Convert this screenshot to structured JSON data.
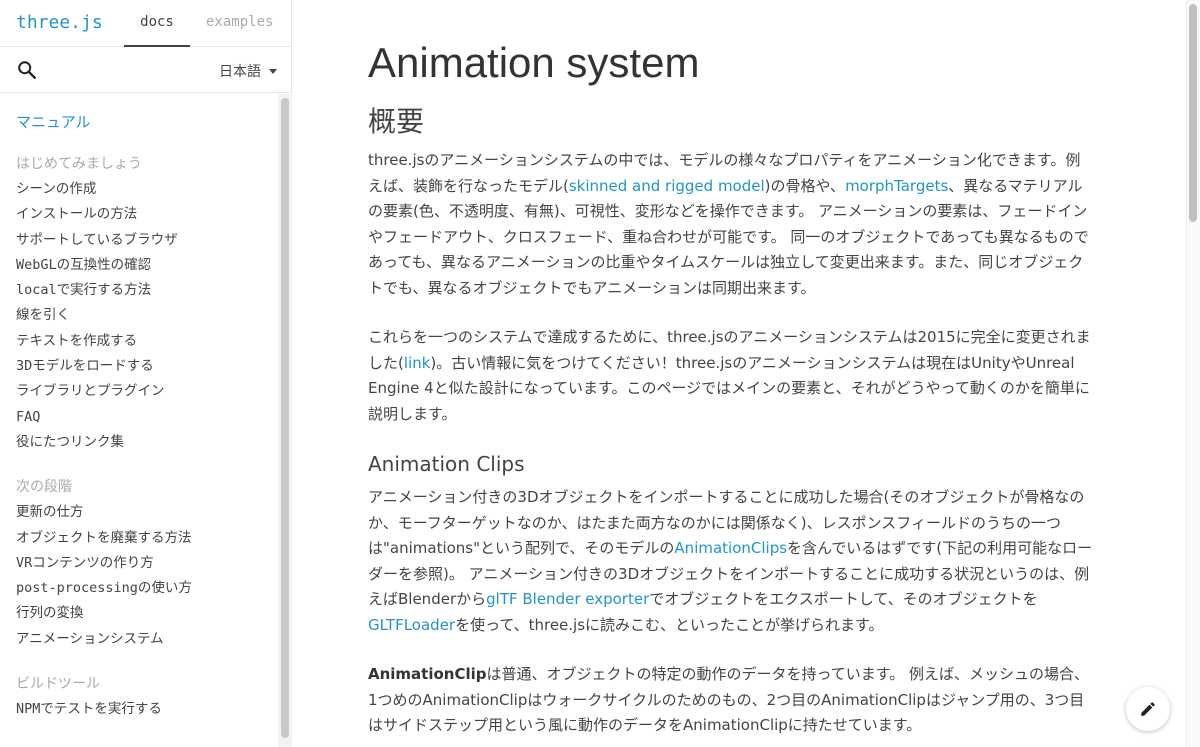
{
  "header": {
    "logo": "three.js",
    "tabs": [
      {
        "label": "docs",
        "active": true
      },
      {
        "label": "examples",
        "active": false
      }
    ]
  },
  "search": {
    "icon": "search-icon"
  },
  "language": {
    "selected": "日本語"
  },
  "nav": {
    "manual_title": "マニュアル",
    "sections": [
      {
        "title": "はじめてみましょう",
        "items": [
          "シーンの作成",
          "インストールの方法",
          "サポートしているブラウザ",
          "WebGLの互換性の確認",
          "localで実行する方法",
          "線を引く",
          "テキストを作成する",
          "3Dモデルをロードする",
          "ライブラリとプラグイン",
          "FAQ",
          "役にたつリンク集"
        ]
      },
      {
        "title": "次の段階",
        "items": [
          "更新の仕方",
          "オブジェクトを廃棄する方法",
          "VRコンテンツの作り方",
          "post-processingの使い方",
          "行列の変換",
          "アニメーションシステム"
        ]
      },
      {
        "title": "ビルドツール",
        "items": [
          "NPMでテストを実行する"
        ]
      }
    ]
  },
  "content": {
    "title": "Animation system",
    "overview_heading": "概要",
    "p1": {
      "t1": "three.jsのアニメーションシステムの中では、モデルの様々なプロパティをアニメーション化できます。例えば、装飾を行なったモデル(",
      "link1": "skinned and rigged model",
      "t2": ")の骨格や、",
      "link2": "morphTargets",
      "t3": "、異なるマテリアルの要素(色、不透明度、有無)、可視性、変形などを操作できます。 アニメーションの要素は、フェードインやフェードアウト、クロスフェード、重ね合わせが可能です。 同一のオブジェクトであっても異なるものであっても、異なるアニメーションの比重やタイムスケールは独立して変更出来ます。また、同じオブジェクトでも、異なるオブジェクトでもアニメーションは同期出来ます。"
    },
    "p2": {
      "t1": "これらを一つのシステムで達成するために、three.jsのアニメーションシステムは2015に完全に変更されました(",
      "link1": "link",
      "t2": ")。古い情報に気をつけてください！three.jsのアニメーションシステムは現在はUnityやUnreal Engine 4と似た設計になっています。このページではメインの要素と、それがどうやって動くのかを簡単に説明します。"
    },
    "clips_heading": "Animation Clips",
    "p3": {
      "t1": "アニメーション付きの3Dオブジェクトをインポートすることに成功した場合(そのオブジェクトが骨格なのか、モーフターゲットなのか、はたまた両方なのかには関係なく)、レスポンスフィールドのうちの一つは\"animations\"という配列で、そのモデルの",
      "link1": "AnimationClips",
      "t2": "を含んでいるはずです(下記の利用可能なローダーを参照)。 アニメーション付きの3Dオブジェクトをインポートすることに成功する状況というのは、例えばBlenderから",
      "link2": "glTF Blender exporter",
      "t3": "でオブジェクトをエクスポートして、そのオブジェクトを",
      "link3": "GLTFLoader",
      "t4": "を使って、three.jsに読みこむ、といったことが挙げられます。"
    },
    "p4": {
      "strong": "AnimationClip",
      "t1": "は普通、オブジェクトの特定の動作のデータを持っています。 例えば、メッシュの場合、1つめのAnimationClipはウォークサイクルのためのもの、2つ目のAnimationClipはジャンプ用の、3つ目はサイドステップ用という風に動作のデータをAnimationClipに持たせています。"
    }
  },
  "edit_button": {
    "icon": "pencil-icon"
  },
  "colors": {
    "link": "#2194ce",
    "text": "#444444"
  }
}
